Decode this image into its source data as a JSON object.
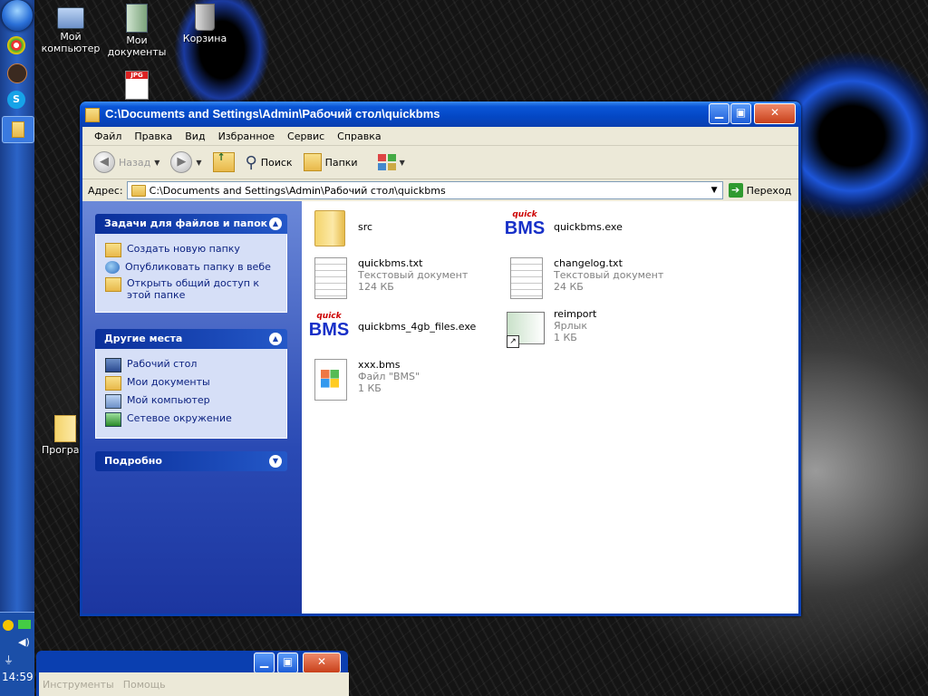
{
  "desktop": {
    "icons": [
      {
        "label_line1": "Мой",
        "label_line2": "компьютер",
        "icon": "my-computer-icon"
      },
      {
        "label_line1": "Мои",
        "label_line2": "документы",
        "icon": "my-documents-icon"
      },
      {
        "label_line1": "Корзина",
        "label_line2": "",
        "icon": "recycle-bin-icon"
      },
      {
        "label_line1": "Програм",
        "label_line2": "",
        "icon": "folder-icon"
      }
    ]
  },
  "taskbar": {
    "clock": "14:59"
  },
  "window": {
    "title": "C:\\Documents and Settings\\Admin\\Рабочий стол\\quickbms",
    "menu": [
      "Файл",
      "Правка",
      "Вид",
      "Избранное",
      "Сервис",
      "Справка"
    ],
    "toolbar": {
      "back": "Назад",
      "search": "Поиск",
      "folders": "Папки"
    },
    "address": {
      "label": "Адрес:",
      "value": "C:\\Documents and Settings\\Admin\\Рабочий стол\\quickbms",
      "go": "Переход"
    },
    "tasks_panel": {
      "title": "Задачи для файлов и папок",
      "items": [
        "Создать новую папку",
        "Опубликовать папку в вебе",
        "Открыть общий доступ к этой папке"
      ]
    },
    "places_panel": {
      "title": "Другие места",
      "items": [
        "Рабочий стол",
        "Мои документы",
        "Мой компьютер",
        "Сетевое окружение"
      ]
    },
    "details_panel": {
      "title": "Подробно"
    },
    "files": [
      {
        "name": "src",
        "type": "",
        "size": "",
        "icon": "folder-icon"
      },
      {
        "name": "quickbms.exe",
        "type": "",
        "size": "",
        "icon": "bms-app-icon"
      },
      {
        "name": "quickbms.txt",
        "type": "Текстовый документ",
        "size": "124 КБ",
        "icon": "text-document-icon"
      },
      {
        "name": "changelog.txt",
        "type": "Текстовый документ",
        "size": "24 КБ",
        "icon": "text-document-icon"
      },
      {
        "name": "quickbms_4gb_files.exe",
        "type": "",
        "size": "",
        "icon": "bms-app-icon"
      },
      {
        "name": "reimport",
        "type": "Ярлык",
        "size": "1 КБ",
        "icon": "shortcut-icon"
      },
      {
        "name": "xxx.bms",
        "type": "Файл \"BMS\"",
        "size": "1 КБ",
        "icon": "windows-file-icon"
      }
    ],
    "bms_logo": {
      "top": "quick",
      "main": "BMS"
    }
  },
  "second_window": {
    "menu": [
      "Инструменты",
      "Помощь"
    ]
  }
}
